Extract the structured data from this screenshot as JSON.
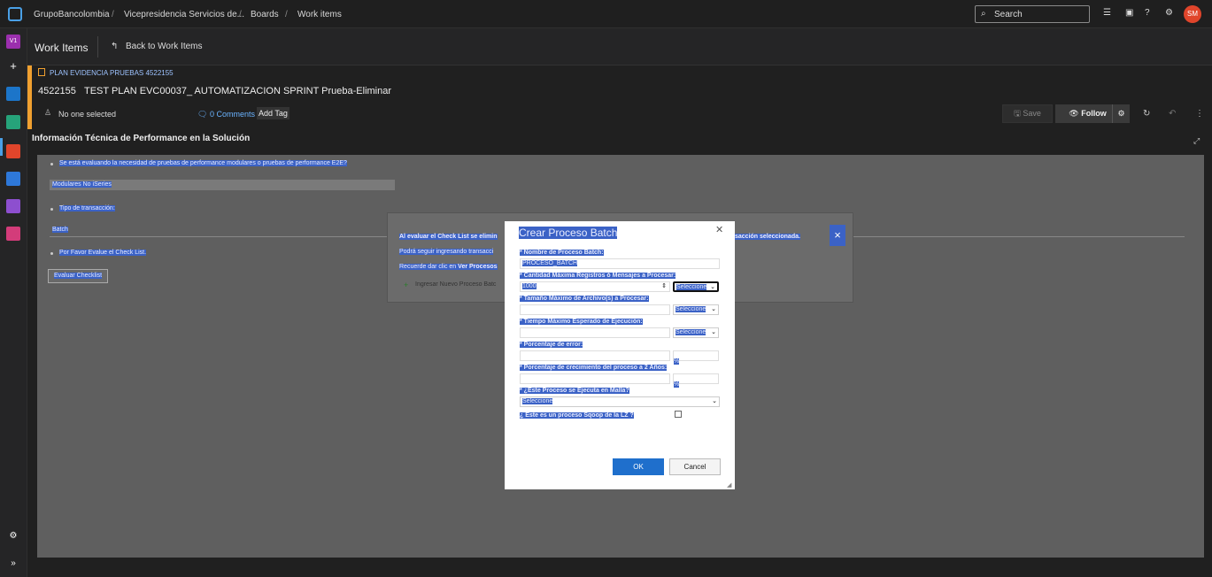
{
  "topbar": {
    "breadcrumbs": [
      "GrupoBancolombia",
      "Vicepresidencia Servicios de...",
      "Boards",
      "Work items"
    ],
    "search_placeholder": "Search",
    "avatar_initials": "SM"
  },
  "leftrail": {
    "project_initials": "V1"
  },
  "header": {
    "title": "Work Items",
    "back_label": "Back to Work Items"
  },
  "work_item": {
    "type_label": "PLAN EVIDENCIA PRUEBAS 4522155",
    "id": "4522155",
    "title": "TEST PLAN EVC00037_ AUTOMATIZACION SPRINT Prueba-Eliminar",
    "assigned": "No one selected",
    "comments": "0 Comments",
    "add_tag": "Add Tag",
    "save_label": "Save",
    "follow_label": "Follow",
    "section_title": "Información Técnica de Performance en la Solución"
  },
  "form": {
    "q1": "Se está evaluando la necesidad de pruebas de performance modulares o pruebas de performance E2E?",
    "a1": "Modulares No iSeries",
    "q2": "Tipo de transacción:",
    "a2": "Batch",
    "q3": "Por Favor Evalue el Check List.",
    "evaluate_btn": "Evaluar Checklist"
  },
  "overlay": {
    "line1_left": "Al evaluar el Check List se elimin",
    "line1_right": "sacción seleccionada.",
    "line2": "Podrá seguir ingresando transacci",
    "line3_pre": "Recuerde dar clic en ",
    "line3_bold": "Ver Procesos",
    "add_label": "Ingresar Nuevo Proceso Batc"
  },
  "dialog": {
    "title": "Crear Proceso Batch",
    "label_name": "* Nombre de Proceso Batch:",
    "value_name": "PROCESO_BATCH",
    "label_records": "* Cantidad Máxima Registros ó Mensajes a Procesar:",
    "value_records": "1000",
    "select_records": "Seleccione",
    "label_filesize": "* Tamaño Máximo de Archivo(s) a Procesar:",
    "select_filesize": "Seleccione",
    "label_time": "* Tiempo Máximo Esperado de Ejecución:",
    "select_time": "Seleccione",
    "label_error": "* Porcentaje de error:",
    "pct_symbol": "%",
    "label_growth": "* Porcentaje de crecimiento del proceso a 2 Años:",
    "label_mesh": "* ¿Este Proceso se Ejecuta en Malla?",
    "select_mesh": "Seleccione",
    "label_sqoop": "¿ Éste es un proceso Sqoop de la LZ ?",
    "ok_label": "OK",
    "cancel_label": "Cancel"
  }
}
